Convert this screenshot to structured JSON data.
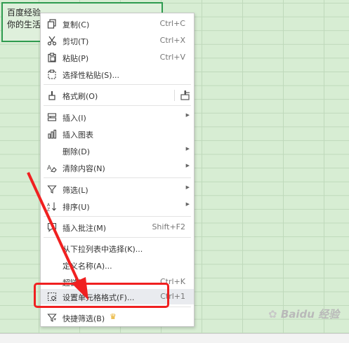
{
  "cell": {
    "line1": "百度经验",
    "line2": "你的生活:"
  },
  "menu": {
    "copy": {
      "label": "复制(C)",
      "shortcut": "Ctrl+C"
    },
    "cut": {
      "label": "剪切(T)",
      "shortcut": "Ctrl+X"
    },
    "paste": {
      "label": "粘贴(P)",
      "shortcut": "Ctrl+V"
    },
    "paste_special": {
      "label": "选择性粘贴(S)..."
    },
    "format_painter": {
      "label": "格式刷(O)"
    },
    "insert": {
      "label": "插入(I)"
    },
    "insert_chart": {
      "label": "插入图表"
    },
    "delete": {
      "label": "删除(D)"
    },
    "clear": {
      "label": "清除内容(N)"
    },
    "filter": {
      "label": "筛选(L)"
    },
    "sort": {
      "label": "排序(U)"
    },
    "comment": {
      "label": "插入批注(M)",
      "shortcut": "Shift+F2"
    },
    "pick_list": {
      "label": "从下拉列表中选择(K)..."
    },
    "define_name": {
      "label": "定义名称(A)..."
    },
    "hyperlink": {
      "label": "超链接",
      "shortcut": "Ctrl+K"
    },
    "format_cells": {
      "label": "设置单元格格式(F)...",
      "shortcut": "Ctrl+1"
    },
    "quick_filter": {
      "label": "快捷筛选(B)"
    }
  },
  "watermark": "Baidu 经验",
  "colors": {
    "annotation": "#f02020",
    "selection_border": "#2e9b4f",
    "grid_background": "#d7edd3",
    "menu_highlight": "#e9ebef"
  },
  "icons": {
    "copy": "copy-icon",
    "cut": "scissors-icon",
    "paste": "paste-icon",
    "paste_special": "paste-special-icon",
    "format_painter": "brush-icon",
    "insert": "insert-row-icon",
    "insert_chart": "bar-chart-icon",
    "clear": "eraser-icon",
    "filter": "funnel-icon",
    "sort": "sort-icon",
    "comment": "comment-icon",
    "format_cells": "format-cells-icon",
    "quick_filter": "quick-filter-icon",
    "submenu": "chevron-right-icon",
    "premium": "crown-icon"
  }
}
